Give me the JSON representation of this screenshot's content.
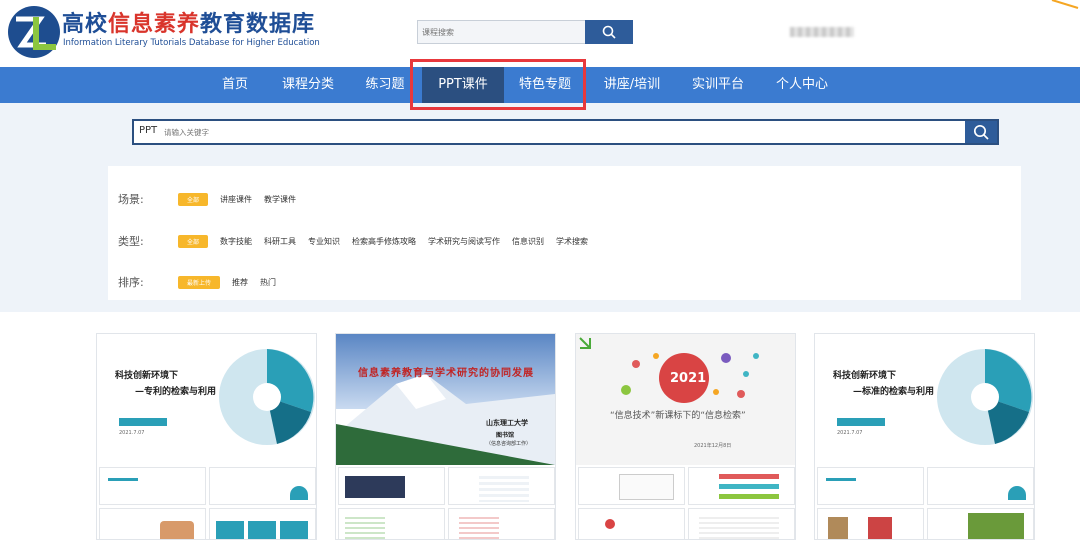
{
  "site": {
    "title_part1": "高校",
    "title_part2": "信息素养",
    "title_part3": "教育数据库",
    "subtitle": "Information Literary Tutorials Database for Higher Education"
  },
  "top_search": {
    "placeholder": "课程搜索"
  },
  "nav": {
    "items": [
      {
        "label": "首页"
      },
      {
        "label": "课程分类"
      },
      {
        "label": "练习题"
      },
      {
        "label": "PPT课件"
      },
      {
        "label": "特色专题"
      },
      {
        "label": "讲座/培训"
      },
      {
        "label": "实训平台"
      },
      {
        "label": "个人中心"
      }
    ],
    "active": "PPT课件"
  },
  "main_search": {
    "prefix": "PPT",
    "placeholder": "请输入关键字"
  },
  "filters": {
    "scene": {
      "label": "场景:",
      "tags": [
        "全部",
        "讲座课件",
        "教学课件"
      ]
    },
    "type": {
      "label": "类型:",
      "tags": [
        "全部",
        "数字技能",
        "科研工具",
        "专业知识",
        "检索高手修炼攻略",
        "学术研究与阅读写作",
        "信息识别",
        "学术搜索"
      ]
    },
    "sort": {
      "label": "排序:",
      "tags": [
        "最新上传",
        "推荐",
        "热门"
      ]
    }
  },
  "cards": [
    {
      "title1": "科技创新环境下",
      "title2": "—专利的检索与利用",
      "date": "2021.7.07"
    },
    {
      "banner": "信息素养教育与学术研究的协同发展",
      "org": "山东理工大学",
      "dept": "图书馆",
      "sub": "（信息咨询部工作）"
    },
    {
      "year": "2021",
      "title": "“信息技术”新课标下的“信息检索”",
      "info": "2021年12月8日"
    },
    {
      "title1": "科技创新环境下",
      "title2": "—标准的检索与利用",
      "date": "2021.7.07"
    }
  ],
  "colors": {
    "nav": "#3b7bd0",
    "nav_active": "#2b4f80",
    "accent": "#f7b72b",
    "highlight": "#e8383c"
  }
}
